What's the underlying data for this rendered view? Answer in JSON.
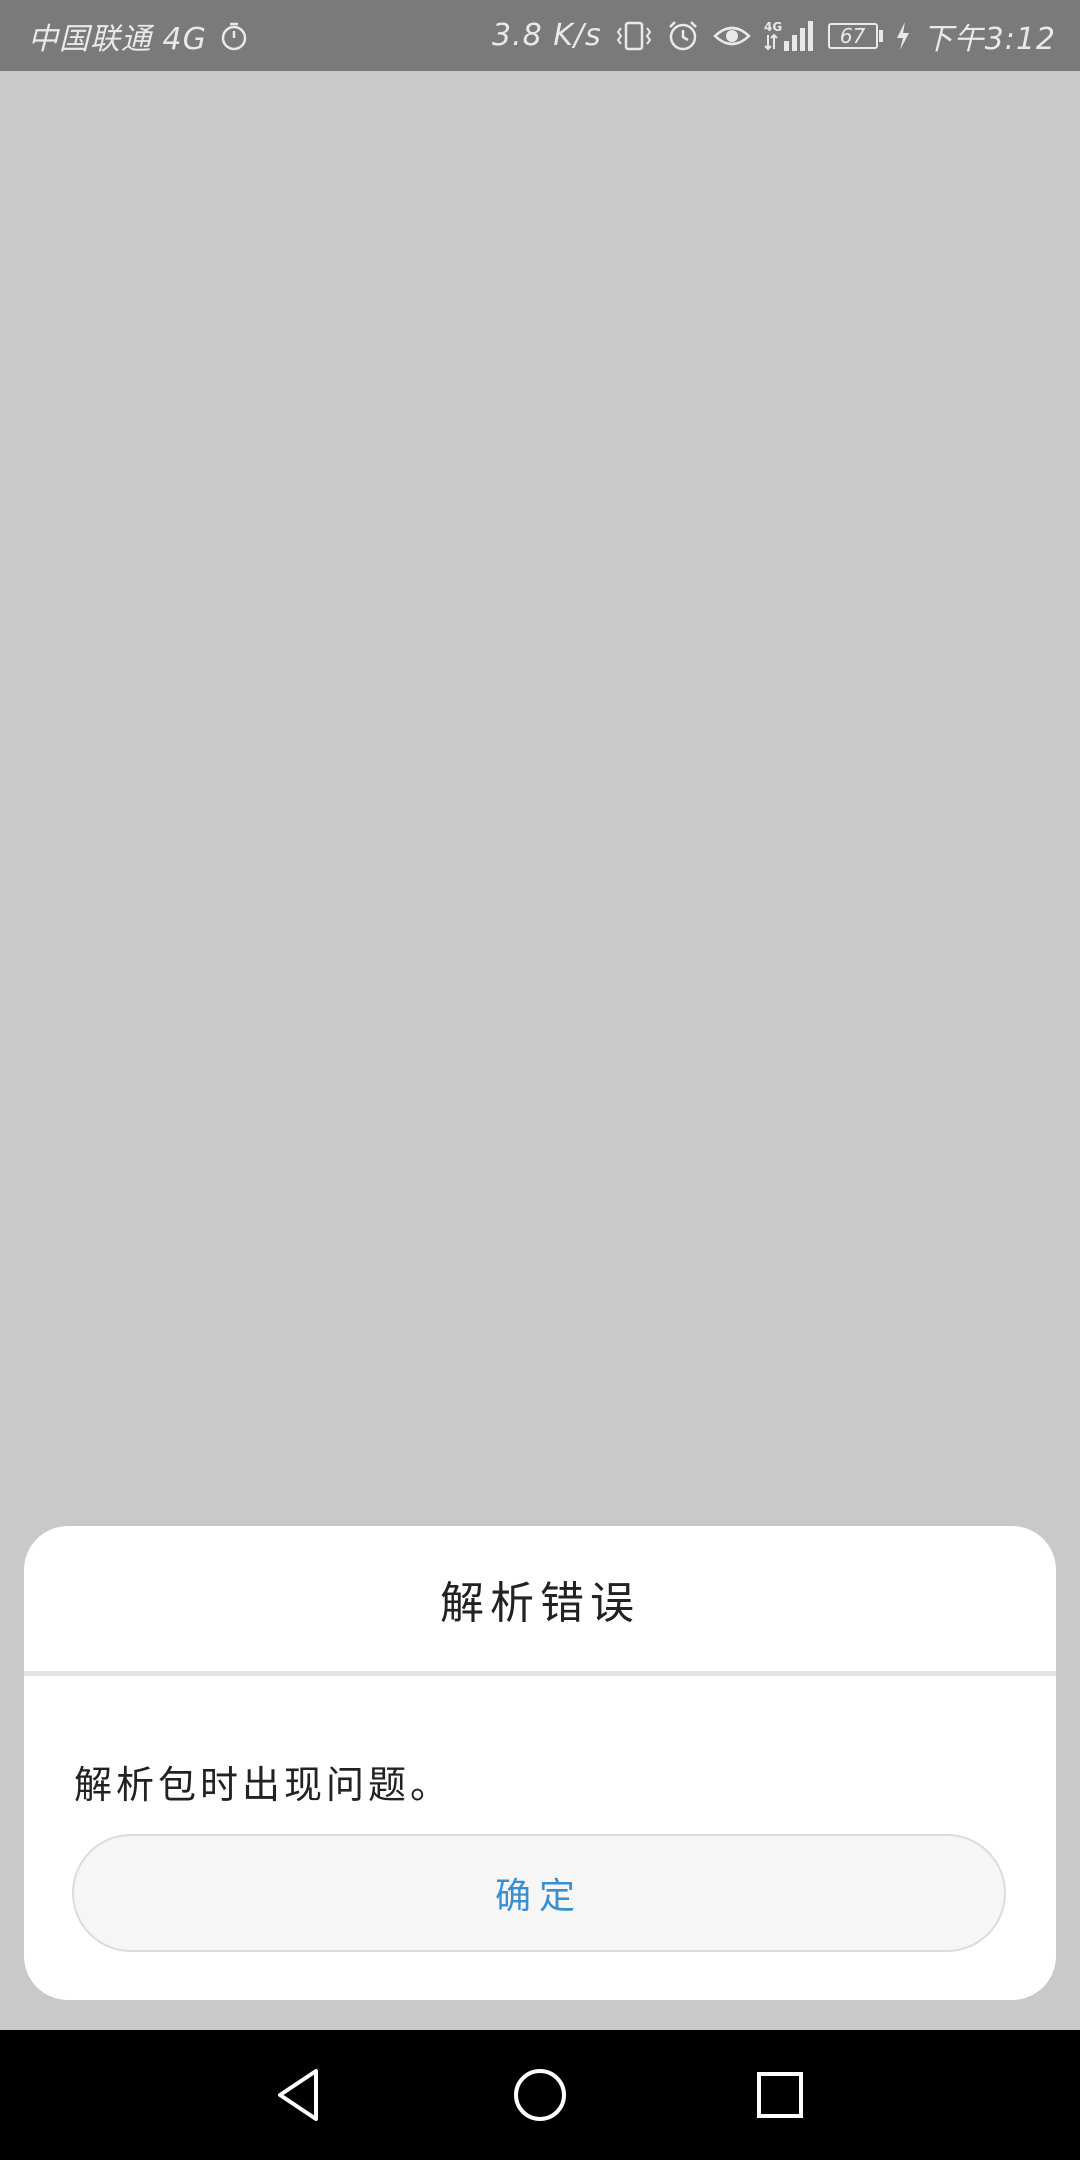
{
  "status_bar": {
    "carrier": "中国联通 4G",
    "network_speed": "3.8 K/s",
    "network_type": "4G",
    "battery_level": "67",
    "time": "下午3:12",
    "icons": [
      "stopwatch-icon",
      "vibrate-icon",
      "alarm-icon",
      "eye-icon",
      "signal-icon",
      "battery-icon",
      "charging-icon"
    ]
  },
  "dialog": {
    "title": "解析错误",
    "message": "解析包时出现问题。",
    "ok_button": "确定",
    "accent_color": "#3a8fd0"
  },
  "nav_bar": {
    "icons": [
      "back-icon",
      "home-icon",
      "recents-icon"
    ]
  },
  "colors": {
    "background": "#c9c9c9",
    "status_bar": "#7a7a7a",
    "nav_bar": "#000000"
  }
}
